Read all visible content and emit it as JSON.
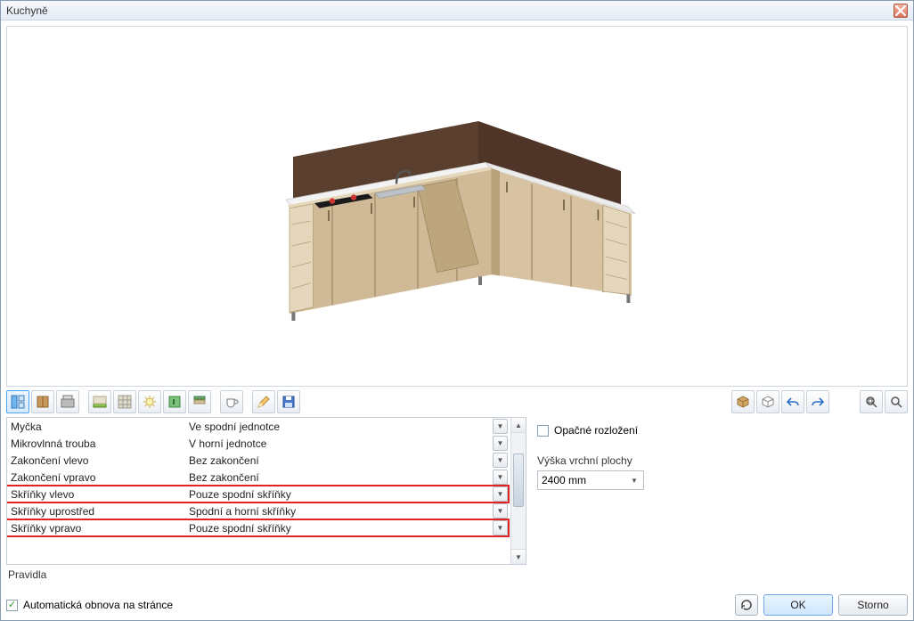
{
  "window": {
    "title": "Kuchyně"
  },
  "toolbar": {
    "buttons": [
      {
        "name": "view-layout-icon",
        "active": true
      },
      {
        "name": "cabinet-icon"
      },
      {
        "name": "kitchen-icon"
      },
      {
        "name": "sep"
      },
      {
        "name": "counter-icon"
      },
      {
        "name": "grid-icon"
      },
      {
        "name": "light-icon"
      },
      {
        "name": "handle-icon"
      },
      {
        "name": "edge-icon"
      },
      {
        "name": "sep"
      },
      {
        "name": "cup-icon"
      },
      {
        "name": "sep"
      },
      {
        "name": "pencil-icon"
      },
      {
        "name": "save-icon"
      }
    ],
    "right_buttons": [
      {
        "name": "box-icon"
      },
      {
        "name": "cube-icon"
      },
      {
        "name": "undo-icon"
      },
      {
        "name": "redo-icon"
      }
    ],
    "far_right_buttons": [
      {
        "name": "zoom-fit-icon"
      },
      {
        "name": "zoom-icon"
      }
    ]
  },
  "properties": {
    "rows": [
      {
        "label": "Myčka",
        "value": "Ve spodní jednotce"
      },
      {
        "label": "Mikrovlnná trouba",
        "value": "V horní jednotce"
      },
      {
        "label": "Zakončení vlevo",
        "value": "Bez zakončení"
      },
      {
        "label": "Zakončení vpravo",
        "value": "Bez zakončení"
      },
      {
        "label": "Skříňky vlevo",
        "value": "Pouze spodní skříňky",
        "hl": true
      },
      {
        "label": "Skříňky uprostřed",
        "value": "Spodní a horní skříňky"
      },
      {
        "label": "Skříňky vpravo",
        "value": "Pouze spodní skříňky",
        "hl": true
      }
    ],
    "status": "Pravidla"
  },
  "right": {
    "reverse_label": "Opačné rozložení",
    "reverse_checked": false,
    "height_label": "Výška vrchní plochy",
    "height_value": "2400 mm"
  },
  "footer": {
    "auto_label": "Automatická obnova na stránce",
    "auto_checked": true,
    "ok": "OK",
    "cancel": "Storno"
  }
}
